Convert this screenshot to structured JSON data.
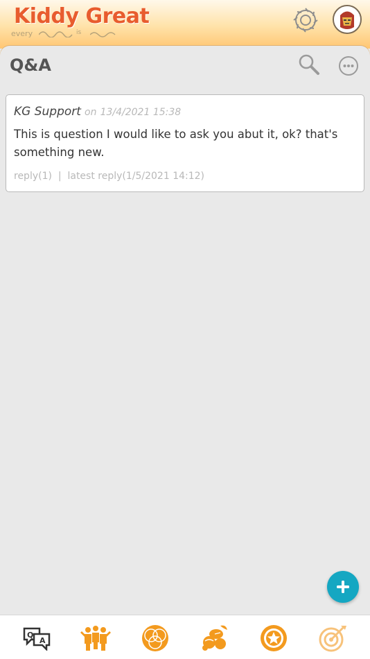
{
  "app": {
    "logo_title": "Kiddy Great",
    "logo_tag_every": "every",
    "logo_tag_is": "is",
    "colors": {
      "brand": "#e85c2e",
      "header_gradient_top": "#fff8ea",
      "header_gradient_bottom": "#ffc673",
      "accent": "#f39a1e",
      "fab": "#15a7c2"
    }
  },
  "header": {
    "settings_icon": "gear-icon",
    "avatar_icon": "avatar-icon"
  },
  "page": {
    "title": "Q&A",
    "search_icon": "search-icon",
    "more_icon": "more-icon"
  },
  "questions": [
    {
      "author": "KG Support",
      "on_label": "on",
      "date": "13/4/2021 15:38",
      "body": "This is question I would like to ask you abut it, ok? that's something new.",
      "footer": "reply(1)  |  latest reply(1/5/2021 14:12)"
    }
  ],
  "fab": {
    "icon": "plus-icon"
  },
  "bottom_nav": [
    {
      "icon": "qa-chat-icon",
      "active": true
    },
    {
      "icon": "community-icon",
      "active": false
    },
    {
      "icon": "globe-icon",
      "active": false
    },
    {
      "icon": "fruit-basket-icon",
      "active": false
    },
    {
      "icon": "star-badge-icon",
      "active": false
    },
    {
      "icon": "target-icon",
      "active": false
    }
  ]
}
